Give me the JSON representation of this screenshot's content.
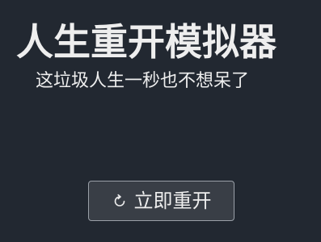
{
  "header": {
    "title": "人生重开模拟器",
    "subtitle": "这垃圾人生一秒也不想呆了"
  },
  "actions": {
    "restart_label": "立即重开",
    "restart_icon": "restart-icon"
  },
  "colors": {
    "background": "#222831",
    "text": "#eeeeee",
    "button_background": "#393e46",
    "button_border": "#9aa0a8"
  }
}
